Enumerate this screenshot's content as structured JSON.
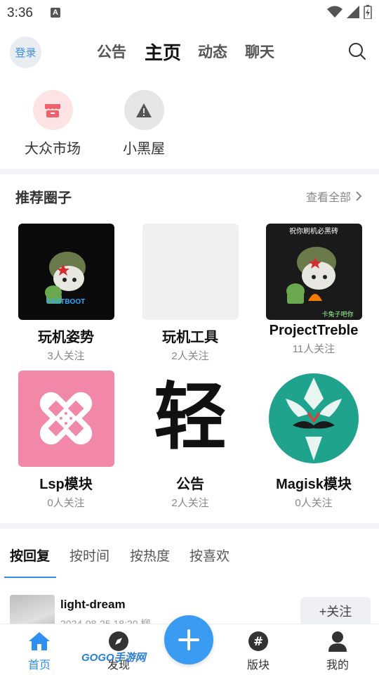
{
  "status": {
    "time": "3:36"
  },
  "header": {
    "login": "登录",
    "tabs": [
      {
        "label": "公告",
        "active": false
      },
      {
        "label": "主页",
        "active": true
      },
      {
        "label": "动态",
        "active": false
      },
      {
        "label": "聊天",
        "active": false
      }
    ]
  },
  "entries": [
    {
      "label": "大众市场",
      "icon": "store-icon",
      "color": "#f0616b"
    },
    {
      "label": "小黑屋",
      "icon": "warning-icon",
      "color": "#555555"
    }
  ],
  "recommended": {
    "title": "推荐圈子",
    "view_all": "查看全部",
    "cards": [
      {
        "name": "玩机姿势",
        "follow": "3人关注",
        "thumb_text": "FASTBOOT"
      },
      {
        "name": "玩机工具",
        "follow": "2人关注"
      },
      {
        "name": "ProjectTreble",
        "follow": "11人关注",
        "thumb_top": "祝你刷机必黑砖",
        "thumb_bottom": "卡兔子吧你"
      },
      {
        "name": "Lsp模块",
        "follow": "0人关注"
      },
      {
        "name": "公告",
        "follow": "2人关注",
        "thumb_text": "轻"
      },
      {
        "name": "Magisk模块",
        "follow": "0人关注"
      }
    ]
  },
  "sort_tabs": [
    {
      "label": "按回复",
      "active": true
    },
    {
      "label": "按时间",
      "active": false
    },
    {
      "label": "按热度",
      "active": false
    },
    {
      "label": "按喜欢",
      "active": false
    }
  ],
  "post": {
    "username": "light-dream",
    "meta": "2024-08-25 18:20 柳",
    "follow_btn": "+关注"
  },
  "bottom_nav": [
    {
      "label": "首页",
      "icon": "home-icon",
      "active": true
    },
    {
      "label": "发现",
      "icon": "compass-icon",
      "active": false
    },
    {
      "label": "版块",
      "icon": "hashtag-icon",
      "active": false
    },
    {
      "label": "我的",
      "icon": "user-icon",
      "active": false
    }
  ],
  "watermark": "GOGO手游网",
  "colors": {
    "accent": "#3a9bf2",
    "active_nav": "#2f8ff0"
  }
}
